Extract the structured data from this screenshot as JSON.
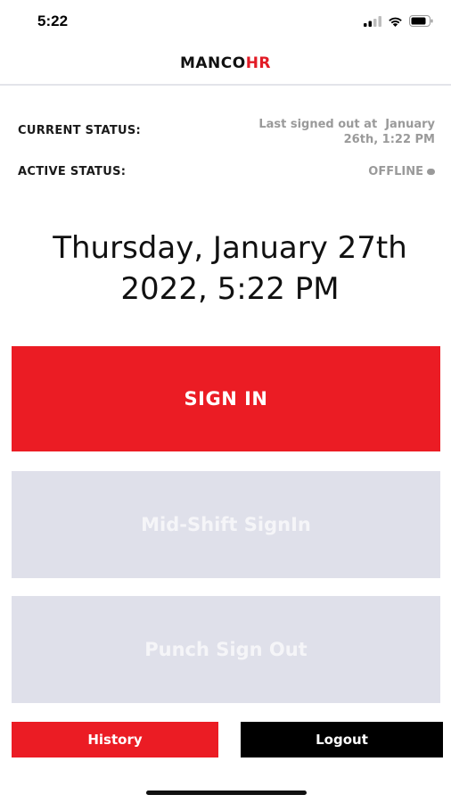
{
  "status_bar": {
    "time": "5:22",
    "icons": [
      "signal-icon",
      "wifi-icon",
      "battery-icon"
    ]
  },
  "header": {
    "brand_prefix": "MANCO",
    "brand_suffix": "HR",
    "brand_accent_color": "#e21b26"
  },
  "current_status": {
    "label": "CURRENT STATUS:",
    "value_line1": "Last signed out at  January",
    "value_line2": "26th, 1:22 PM"
  },
  "active_status": {
    "label": "ACTIVE STATUS:",
    "value": "OFFLINE"
  },
  "datetime": {
    "line1": "Thursday, January 27th",
    "line2": "2022, 5:22 PM"
  },
  "buttons": {
    "sign_in": "SIGN IN",
    "mid_shift": "Mid-Shift SignIn",
    "punch_out": "Punch Sign Out",
    "history": "History",
    "logout": "Logout"
  },
  "colors": {
    "primary_red": "#eb1c24",
    "disabled_bg": "#dfe0ea",
    "logout_bg": "#000000"
  }
}
